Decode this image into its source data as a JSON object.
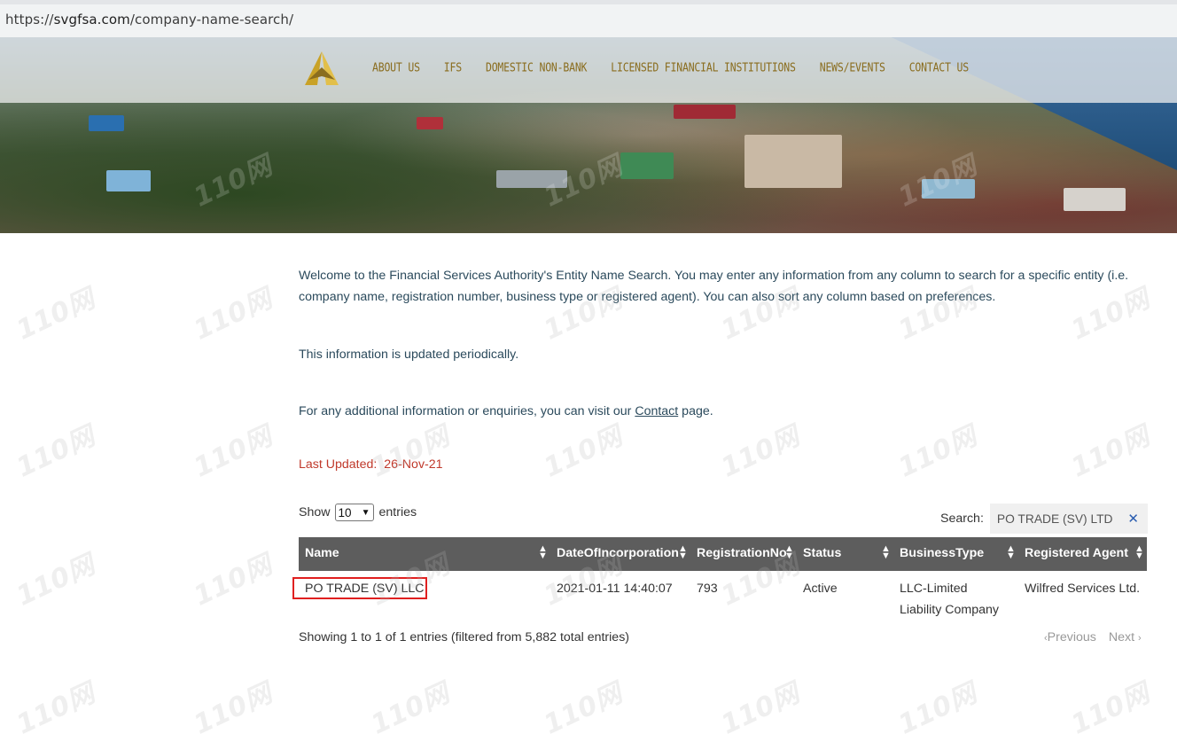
{
  "browser": {
    "url_prefix": "https://",
    "url_host": "svgfsa.com",
    "url_path": "/company-name-search/"
  },
  "nav": {
    "items": [
      "ABOUT US",
      "IFS",
      "DOMESTIC NON-BANK",
      "LICENSED FINANCIAL INSTITUTIONS",
      "NEWS/EVENTS",
      "CONTACT US"
    ]
  },
  "intro": {
    "paragraph1": "Welcome to the Financial Services Authority's Entity Name Search. You may enter any information from any column to search for a specific entity (i.e. company name, registration number, business type or registered agent). You can also sort any column based on preferences.",
    "paragraph2": "This information is updated periodically.",
    "paragraph3_before": "For any additional information or enquiries, you can visit our ",
    "paragraph3_link": "Contact",
    "paragraph3_after": " page.",
    "last_updated_label": "Last Updated:",
    "last_updated_value": "26-Nov-21"
  },
  "table_controls": {
    "show_label": "Show",
    "entries_label": "entries",
    "page_size": "10",
    "search_label": "Search:",
    "search_value": "PO TRADE (SV) LTD"
  },
  "table": {
    "columns": [
      "Name",
      "DateOfIncorporation",
      "RegistrationNo",
      "Status",
      "BusinessType",
      "Registered Agent"
    ],
    "rows": [
      {
        "name": "PO TRADE (SV) LLC",
        "date": "2021-01-11 14:40:07",
        "reg_no": "793",
        "status": "Active",
        "business_type_line1": "LLC-Limited",
        "business_type_line2": "Liability Company",
        "agent": "Wilfred Services Ltd."
      }
    ],
    "info": "Showing 1 to 1 of 1 entries (filtered from 5,882 total entries)",
    "prev_label": "Previous",
    "next_label": "Next"
  },
  "watermark_text": "110网",
  "colors": {
    "nav_text": "#8a6d1f",
    "header_bg": "#5d5d5d",
    "updated_text": "#c0392b",
    "highlight_border": "#e02020",
    "clear_icon": "#2a5db0"
  }
}
